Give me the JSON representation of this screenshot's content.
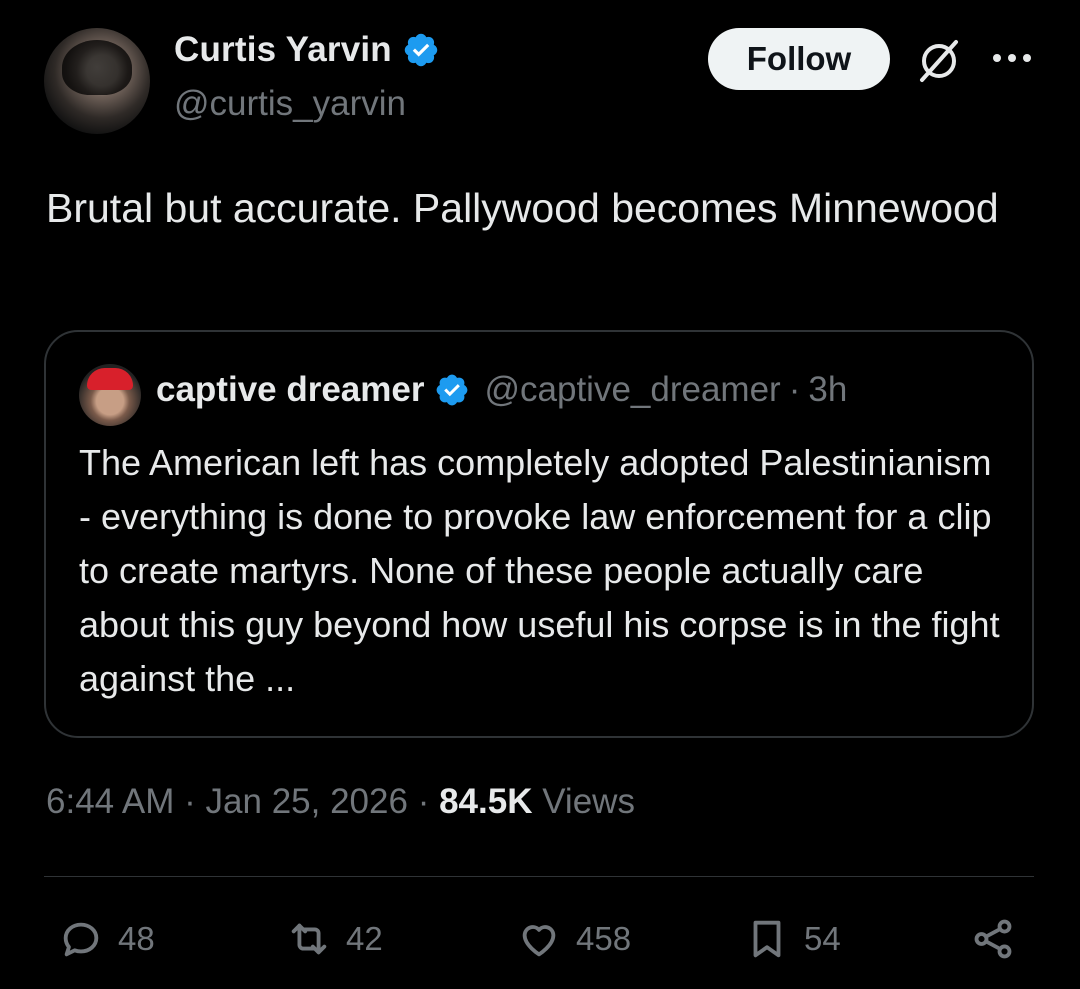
{
  "author": {
    "display_name": "Curtis Yarvin",
    "handle": "@curtis_yarvin"
  },
  "follow_label": "Follow",
  "tweet_text": "Brutal but accurate. Pallywood becomes Minnewood",
  "quote": {
    "display_name": "captive dreamer",
    "handle": "@captive_dreamer",
    "separator": "·",
    "time": "3h",
    "text": "The American left has completely adopted Palestinianism - everything is done to provoke law enforcement for a clip to create martyrs.  None of these people actually care about this guy beyond how useful his corpse is in the fight against the ..."
  },
  "meta": {
    "time": "6:44 AM",
    "sep1": "·",
    "date": "Jan 25, 2026",
    "sep2": "·",
    "views_count": "84.5K",
    "views_label": "Views"
  },
  "actions": {
    "replies": "48",
    "reposts": "42",
    "likes": "458",
    "bookmarks": "54"
  },
  "colors": {
    "background": "#000000",
    "text": "#e7e9ea",
    "muted": "#71767b",
    "verified": "#1d9bf0",
    "border": "#2f3336"
  },
  "icons": [
    "verified-badge-icon",
    "grok-icon",
    "more-icon",
    "reply-icon",
    "repost-icon",
    "like-icon",
    "bookmark-icon",
    "share-icon"
  ]
}
